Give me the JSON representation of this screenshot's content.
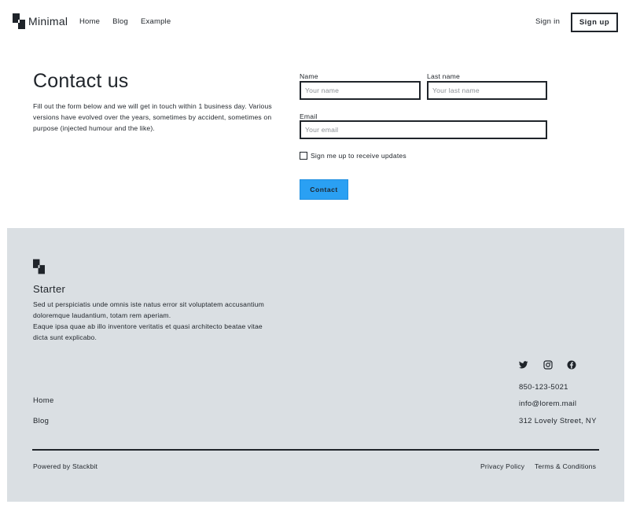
{
  "header": {
    "brand": "Minimal",
    "nav": [
      "Home",
      "Blog",
      "Example"
    ],
    "sign_in": "Sign in",
    "sign_up": "Sign up"
  },
  "contact": {
    "title": "Contact us",
    "description": "Fill out the form below and we will get in touch within 1 business day. Various versions have evolved over the years, sometimes by accident, sometimes on purpose (injected humour and the like).",
    "form": {
      "name_label": "Name",
      "name_placeholder": "Your name",
      "lastname_label": "Last name",
      "lastname_placeholder": "Your last name",
      "email_label": "Email",
      "email_placeholder": "Your email",
      "updates_label": "Sign me up to receive updates",
      "submit_label": "Contact"
    },
    "accent_color": "#2aa0f3"
  },
  "footer": {
    "title": "Starter",
    "description_line1": "Sed ut perspiciatis unde omnis iste natus error sit voluptatem accusantium doloremque laudantium, totam rem aperiam.",
    "description_line2": "Eaque ipsa quae ab illo inventore veritatis et quasi architecto beatae vitae dicta sunt explicabo.",
    "social": [
      "twitter-icon",
      "instagram-icon",
      "facebook-icon"
    ],
    "phone": "850-123-5021",
    "email": "info@lorem.mail",
    "address": "312 Lovely Street, NY",
    "links": [
      "Home",
      "Blog"
    ],
    "powered_by": "Powered by Stackbit",
    "privacy": "Privacy Policy",
    "terms": "Terms & Conditions",
    "background_color": "#dadfe3"
  }
}
